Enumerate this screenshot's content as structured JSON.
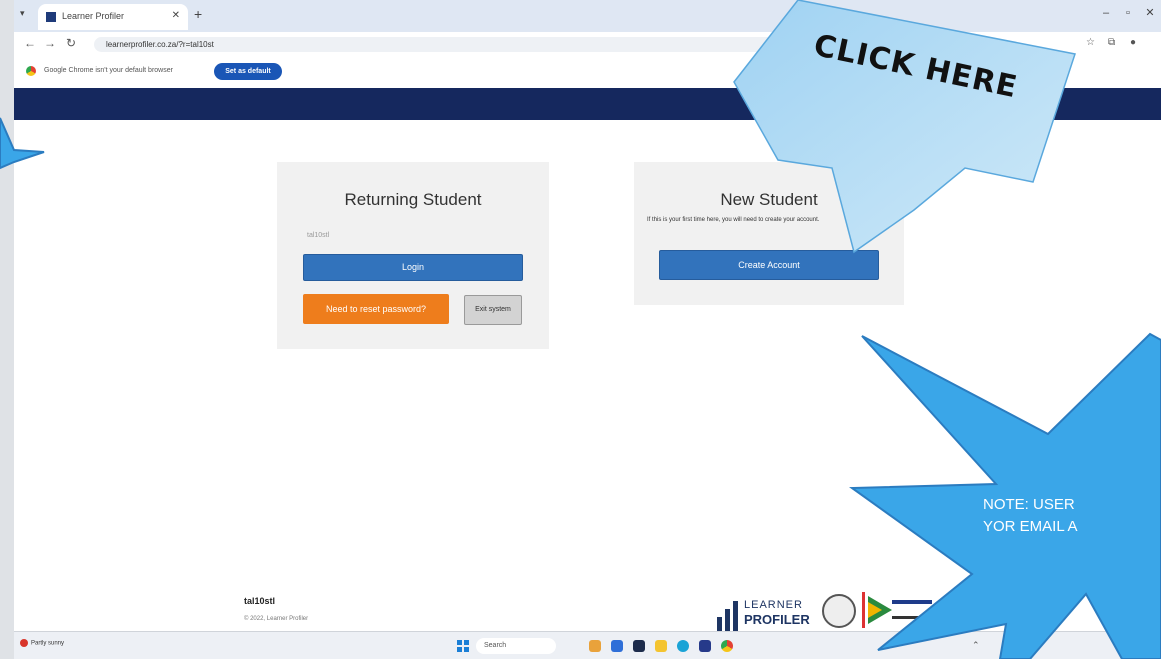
{
  "browser": {
    "tab_title": "Learner Profiler",
    "new_tab": "+",
    "url": "learnerprofiler.co.za/?r=tal10st",
    "infobar_message": "Google Chrome isn't your default browser",
    "set_default_label": "Set as default"
  },
  "returning": {
    "title": "Returning Student",
    "username": "tal10stl",
    "login_label": "Login",
    "reset_label": "Need to reset password?",
    "exit_label": "Exit system"
  },
  "new_student": {
    "title": "New Student",
    "description": "If this is your first time here, you will need to create your account.",
    "create_label": "Create Account"
  },
  "footer": {
    "username": "tal10stl",
    "copyright": "© 2022, Learner Profiler",
    "logo_line1": "LEARNER",
    "logo_line2": "PROFILER"
  },
  "taskbar": {
    "weather": "Partly sunny",
    "search_placeholder": "Search"
  },
  "callouts": {
    "click_here": "CLICK HERE",
    "note_line1": "NOTE: USER",
    "note_line2": "YOR EMAIL A"
  },
  "colors": {
    "header_band": "#15285e",
    "button_blue": "#3273bc",
    "button_orange": "#ee7d1c",
    "callout_blue": "#3aa6e8"
  }
}
